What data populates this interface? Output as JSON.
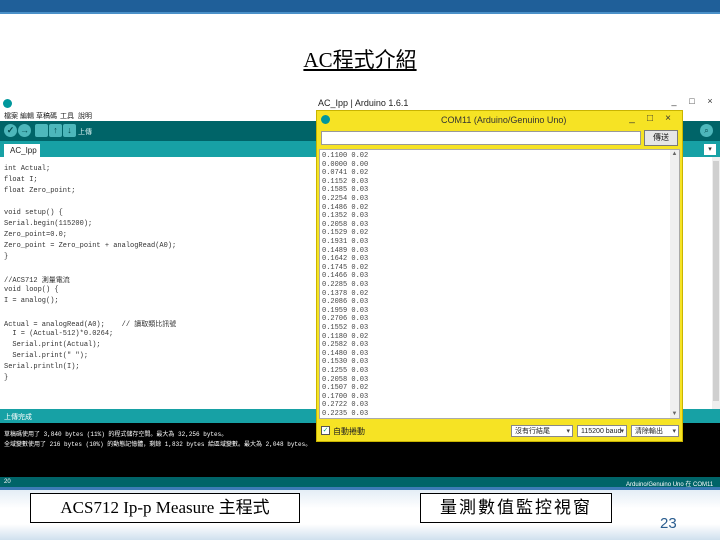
{
  "slide": {
    "title": "AC程式介紹",
    "caption_left": "ACS712 Ip-p Measure 主程式",
    "caption_right": "量測數值監控視窗",
    "page_number": "23"
  },
  "ide": {
    "title": "AC_Ipp | Arduino 1.6.1",
    "window_controls": [
      "_",
      "□",
      "×"
    ],
    "menu": [
      "檔案",
      "編輯",
      "草稿碼",
      "工具",
      "說明"
    ],
    "toolbar_label": "上傳",
    "toolbar_icons": [
      "verify-icon",
      "upload-icon",
      "new-icon",
      "open-icon",
      "save-icon"
    ],
    "tab": "AC_Ipp",
    "code_lines": [
      "int Actual;",
      "float I;",
      "float Zero_point;",
      "",
      "void setup() {",
      "Serial.begin(115200);",
      "Zero_point=0.0;",
      "Zero_point = Zero_point + analogRead(A0);",
      "}",
      "",
      "//ACS712 測量電流",
      "void loop() {",
      "I = analog();",
      "",
      "Actual = analogRead(A0);    // 讀取類比訊號",
      "  I = (Actual-512)*0.0264;",
      "  Serial.print(Actual);",
      "  Serial.print(\" \");",
      "Serial.println(I);",
      "}"
    ],
    "status_text": "上傳完成",
    "console_lines": [
      "草稿碼使用了 3,840 bytes (11%) 的程式儲存空間。最大為 32,256 bytes。",
      "全域變數使用了 216 bytes (10%) 的動態記憶體，剩餘 1,832 bytes 給區域變數。最大為 2,048 bytes。"
    ],
    "footer_line": "20",
    "footer_board": "Arduino/Genuino Uno 在 COM11"
  },
  "serial_monitor": {
    "title": "COM11 (Arduino/Genuino Uno)",
    "window_controls": [
      "_",
      "□",
      "×"
    ],
    "send_label": "傳送",
    "input_value": "",
    "output_lines": [
      "0.1100 0.02",
      "0.0000 0.00",
      "0.0741 0.02",
      "0.1152 0.03",
      "0.1585 0.03",
      "0.2254 0.03",
      "0.1486 0.02",
      "0.1352 0.03",
      "0.2058 0.03",
      "0.1529 0.02",
      "0.1931 0.03",
      "0.1489 0.03",
      "0.1642 0.03",
      "0.1745 0.02",
      "0.1466 0.03",
      "0.2285 0.03",
      "0.1378 0.02",
      "0.2086 0.03",
      "0.1959 0.03",
      "0.2706 0.03",
      "0.1552 0.03",
      "0.1180 0.02",
      "0.2582 0.03",
      "0.1480 0.03",
      "0.1530 0.03",
      "0.1255 0.03",
      "0.2058 0.03",
      "0.1507 0.02",
      "0.1700 0.03",
      "0.2722 0.03",
      "0.2235 0.03"
    ],
    "autoscroll_label": "自動捲動",
    "autoscroll_checked": "✓",
    "line_ending": "沒有行結尾",
    "baud_rate": "115200 baud",
    "clear_label": "清除輸出"
  }
}
